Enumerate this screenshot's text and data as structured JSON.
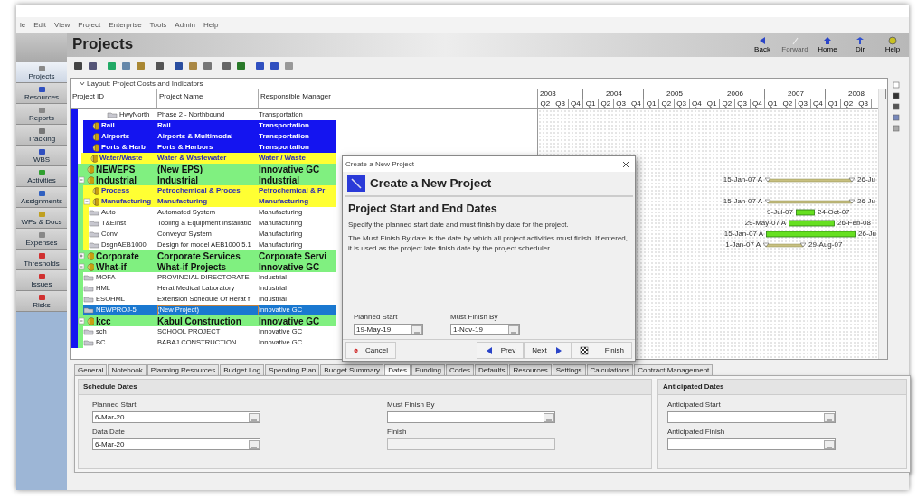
{
  "menu": [
    "le",
    "Edit",
    "View",
    "Project",
    "Enterprise",
    "Tools",
    "Admin",
    "Help"
  ],
  "sidebar": {
    "items": [
      {
        "label": "Projects",
        "selected": true
      },
      {
        "label": "Resources",
        "selected": false
      },
      {
        "label": "Reports",
        "selected": false
      },
      {
        "label": "Tracking",
        "selected": false
      },
      {
        "label": "WBS",
        "selected": false
      },
      {
        "label": "Activities",
        "selected": false
      },
      {
        "label": "Assignments",
        "selected": false
      },
      {
        "label": "WPs & Docs",
        "selected": false
      },
      {
        "label": "Expenses",
        "selected": false
      },
      {
        "label": "Thresholds",
        "selected": false
      },
      {
        "label": "Issues",
        "selected": false
      },
      {
        "label": "Risks",
        "selected": false
      }
    ]
  },
  "header": {
    "title": "Projects",
    "nav": [
      {
        "label": "Back",
        "disabled": false
      },
      {
        "label": "Forward",
        "disabled": true
      },
      {
        "label": "Home",
        "disabled": false
      },
      {
        "label": "Dir",
        "disabled": false
      },
      {
        "label": "Help",
        "disabled": false
      }
    ]
  },
  "layout": {
    "title": "Layout: Project Costs and Indicators",
    "columns": [
      "Project ID",
      "Project Name",
      "Responsible Manager"
    ]
  },
  "timeline": {
    "years": [
      "2003",
      "2004",
      "2005",
      "2006",
      "2007",
      "2008"
    ],
    "quarters": [
      "Q2",
      "Q3",
      "Q4",
      "Q1",
      "Q2",
      "Q3",
      "Q4",
      "Q1",
      "Q2",
      "Q3",
      "Q4",
      "Q1",
      "Q2",
      "Q3",
      "Q4",
      "Q1",
      "Q2",
      "Q3",
      "Q4",
      "Q1",
      "Q2",
      "Q3"
    ]
  },
  "rows": [
    {
      "id": "HwyNorth",
      "name": "Phase 2 - Northbound",
      "manager": "Transportation",
      "kind": "project",
      "selected": false
    },
    {
      "id": "Rail",
      "name": "Rail",
      "manager": "Transportation",
      "kind": "eps",
      "color": "#1414f0",
      "selected": false
    },
    {
      "id": "Airports",
      "name": "Airports & Multimodal",
      "manager": "Transportation",
      "kind": "eps",
      "color": "#1414f0",
      "selected": false
    },
    {
      "id": "Ports & Harb",
      "name": "Ports & Harbors",
      "manager": "Transportation",
      "kind": "eps",
      "color": "#1414f0",
      "selected": false
    },
    {
      "id": "Water/Waste",
      "name": "Water & Wastewater",
      "manager": "Water / Waste",
      "kind": "eps",
      "color": "#ffff33",
      "selected": false
    },
    {
      "id": "NEWEPS",
      "name": "(New EPS)",
      "manager": "Innovative GC",
      "kind": "eps",
      "color": "#80f080",
      "selected": false
    },
    {
      "id": "Industrial",
      "name": "Industrial",
      "manager": "Industrial",
      "kind": "eps",
      "color": "#80f080",
      "selected": false,
      "expanded": true,
      "bar": {
        "kind": "summary",
        "start": "15-Jan-07 A",
        "finish": "26-Ju"
      },
      "children": [
        {
          "id": "Process",
          "name": "Petrochemical & Proces",
          "manager": "Petrochemical & Pr",
          "kind": "eps",
          "color": "#ffff33",
          "selected": false
        },
        {
          "id": "Manufacturing",
          "name": "Manufacturing",
          "manager": "Manufacturing",
          "kind": "eps",
          "color": "#ffff33",
          "selected": false,
          "expanded": true,
          "bar": {
            "kind": "summary",
            "start": "15-Jan-07 A",
            "finish": "26-Ju"
          },
          "children": [
            {
              "id": "Auto",
              "name": "Automated System",
              "manager": "Manufacturing",
              "kind": "project",
              "selected": false,
              "bar": {
                "kind": "activity",
                "start": "9-Jul-07",
                "finish": "24-Oct-07"
              }
            },
            {
              "id": "T&EInst",
              "name": "Tooling & Equipment Installatic",
              "manager": "Manufacturing",
              "kind": "project",
              "selected": false,
              "bar": {
                "kind": "activity",
                "start": "29-May-07 A",
                "finish": "26-Feb-08"
              }
            },
            {
              "id": "Conv",
              "name": "Conveyor System",
              "manager": "Manufacturing",
              "kind": "project",
              "selected": false,
              "bar": {
                "kind": "activity",
                "start": "15-Jan-07 A",
                "finish": "26-Ju"
              }
            },
            {
              "id": "DsgnAEB1000",
              "name": "Design for model AEB1000 5.1",
              "manager": "Manufacturing",
              "kind": "project",
              "selected": false,
              "bar": {
                "kind": "summary",
                "start": "1-Jan-07 A",
                "finish": "29-Aug-07"
              }
            }
          ]
        }
      ]
    },
    {
      "id": "Corporate",
      "name": "Corporate Services",
      "manager": "Corporate Servi",
      "kind": "eps",
      "color": "#80f080",
      "selected": false,
      "expanded": false
    },
    {
      "id": "What-if",
      "name": "What-if Projects",
      "manager": "Innovative GC",
      "kind": "eps",
      "color": "#80f080",
      "selected": false,
      "expanded": true,
      "children": [
        {
          "id": "MOFA",
          "name": "PROVINCIAL DIRECTORATE",
          "manager": "Industrial",
          "kind": "project",
          "selected": false
        },
        {
          "id": "HML",
          "name": "Herat Medical Laboratory",
          "manager": "Industrial",
          "kind": "project",
          "selected": false
        },
        {
          "id": "ESOHML",
          "name": "Extension Schedule Of Herat f",
          "manager": "Industrial",
          "kind": "project",
          "selected": false
        },
        {
          "id": "NEWPROJ-5",
          "name": "(New Project)",
          "manager": "Innovative GC",
          "kind": "project",
          "selected": true
        }
      ]
    },
    {
      "id": "kcc",
      "name": "Kabul Construction",
      "manager": "Innovative GC",
      "kind": "eps",
      "color": "#80f080",
      "selected": false,
      "expanded": true,
      "children": [
        {
          "id": "sch",
          "name": "SCHOOL PROJECT",
          "manager": "Innovative GC",
          "kind": "project",
          "selected": false
        },
        {
          "id": "BC",
          "name": "BABAJ CONSTRUCTION",
          "manager": "Innovative GC",
          "kind": "project",
          "selected": false
        }
      ]
    }
  ],
  "dialog": {
    "window_title": "Create a New Project",
    "title": "Create a New Project",
    "heading": "Project Start and End Dates",
    "paragraphs": [
      "Specify the planned start date and must finish by date for the project.",
      "The Must Finish By date is the date by which all project activities must finish.  If entered, it is used as the project late finish date by the project scheduler."
    ],
    "fields": [
      {
        "label": "Planned Start",
        "value": "19-May-19"
      },
      {
        "label": "Must Finish By",
        "value": "1-Nov-19"
      }
    ],
    "buttons": [
      {
        "label": "Cancel",
        "kind": "cancel"
      },
      {
        "label": "Prev",
        "kind": "prev"
      },
      {
        "label": "Next",
        "kind": "next"
      },
      {
        "label": "Finish",
        "kind": "finish"
      }
    ]
  },
  "detail": {
    "tabs": [
      {
        "label": "General",
        "selected": false
      },
      {
        "label": "Notebook",
        "selected": false
      },
      {
        "label": "Planning Resources",
        "selected": false
      },
      {
        "label": "Budget Log",
        "selected": false
      },
      {
        "label": "Spending Plan",
        "selected": false
      },
      {
        "label": "Budget Summary",
        "selected": false
      },
      {
        "label": "Dates",
        "selected": true
      },
      {
        "label": "Funding",
        "selected": false
      },
      {
        "label": "Codes",
        "selected": false
      },
      {
        "label": "Defaults",
        "selected": false
      },
      {
        "label": "Resources",
        "selected": false
      },
      {
        "label": "Settings",
        "selected": false
      },
      {
        "label": "Calculations",
        "selected": false
      },
      {
        "label": "Contract Management",
        "selected": false
      }
    ],
    "schedule": {
      "title": "Schedule Dates",
      "fields": [
        {
          "label": "Planned Start",
          "value": "6-Mar-20",
          "disabled": false
        },
        {
          "label": "Must Finish By",
          "disabled": false
        },
        {
          "label": "Data Date",
          "value": "6-Mar-20",
          "disabled": false
        },
        {
          "label": "Finish",
          "disabled": true
        }
      ]
    },
    "anticipated": {
      "title": "Anticipated Dates",
      "fields": [
        {
          "label": "Anticipated Start",
          "disabled": false
        },
        {
          "label": "Anticipated Finish",
          "disabled": false
        }
      ]
    }
  }
}
